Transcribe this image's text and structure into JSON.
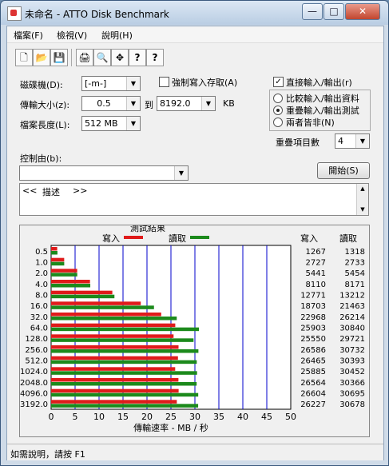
{
  "window": {
    "title": "未命名 - ATTO Disk Benchmark",
    "min_glyph": "—",
    "max_glyph": "□",
    "close_glyph": "✕"
  },
  "menu": [
    "檔案(F)",
    "檢視(V)",
    "說明(H)"
  ],
  "toolbar": {
    "new": "🗋",
    "open": "📂",
    "save": "💾",
    "print": "🖨",
    "preview": "🔍",
    "move": "✥",
    "help": "?",
    "context_help": "?"
  },
  "drive": {
    "label": "磁碟機(D):",
    "value": "[-m-]"
  },
  "transfer": {
    "label": "傳輸大小(z):",
    "from": "0.5",
    "to_label": "到",
    "to": "8192.0",
    "unit": "KB"
  },
  "filelength": {
    "label": "檔案長度(L):",
    "value": "512 MB"
  },
  "force_write": {
    "label": "強制寫入存取(A)",
    "checked": false
  },
  "direct_io": {
    "label": "直接輸入/輸出(r)",
    "checked": true,
    "mark": "✓"
  },
  "io_modes": [
    "比較輸入/輸出資料",
    "重疊輸入/輸出測試",
    "兩者皆非(N)"
  ],
  "io_selected": 1,
  "queue": {
    "label": "重疊項目數",
    "value": "4"
  },
  "controlled_by": {
    "label": "控制由(b):",
    "value": ""
  },
  "start_button": "開始(S)",
  "description": {
    "open": "<<",
    "text": "描述",
    "close": ">>"
  },
  "status": "如需說明，請按 F1",
  "colors": {
    "write": "#e01b1b",
    "read": "#1c8a1c",
    "grid": "#0000cc"
  },
  "chart_data": {
    "type": "bar",
    "title": "測試結果",
    "xlabel": "傳輸速率 - MB / 秒",
    "xlim": [
      0,
      50
    ],
    "xticks": [
      0,
      5,
      10,
      15,
      20,
      25,
      30,
      35,
      40,
      45,
      50
    ],
    "categories": [
      "0.5",
      "1.0",
      "2.0",
      "4.0",
      "8.0",
      "16.0",
      "32.0",
      "64.0",
      "128.0",
      "256.0",
      "512.0",
      "1024.0",
      "2048.0",
      "4096.0",
      "3192.0"
    ],
    "series": [
      {
        "name": "寫入",
        "values": [
          1267,
          2727,
          5441,
          8110,
          12771,
          18703,
          22968,
          25903,
          25550,
          26586,
          26465,
          25885,
          26564,
          26604,
          26227
        ]
      },
      {
        "name": "讀取",
        "values": [
          1318,
          2733,
          5454,
          8171,
          13212,
          21463,
          26214,
          30840,
          29721,
          30732,
          30393,
          30452,
          30366,
          30695,
          30678
        ]
      }
    ],
    "column_headers": [
      "寫入",
      "讀取"
    ],
    "value_scale": 1000
  }
}
